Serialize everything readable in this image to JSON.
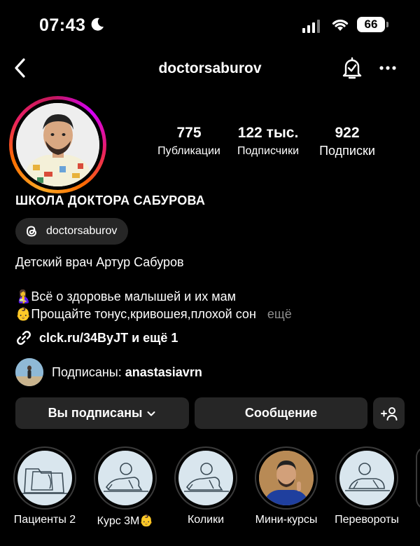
{
  "status_bar": {
    "time": "07:43",
    "battery": "66"
  },
  "header": {
    "username": "doctorsaburov"
  },
  "profile": {
    "stats": [
      {
        "value": "775",
        "label": "Публикации"
      },
      {
        "value": "122 тыс.",
        "label": "Подписчики"
      },
      {
        "value": "922",
        "label": "Подписки"
      }
    ],
    "full_name": "ШКОЛА ДОКТОРА САБУРОВА",
    "threads_handle": "doctorsaburov",
    "bio": {
      "line1": "Детский врач Артур Сабуров",
      "line2": "🤱Всё о здоровье малышей и их мам",
      "line3": "👶Прощайте тонус,кривошея,плохой сон",
      "more": "ещё"
    },
    "link": "clck.ru/34ByJT и ещё 1",
    "followed_by_prefix": "Подписаны: ",
    "followed_by_user": "anastasiavrn"
  },
  "actions": {
    "following_label": "Вы подписаны",
    "message_label": "Сообщение"
  },
  "highlights": [
    {
      "label": "Пациенты 2"
    },
    {
      "label": "Курс 3М👶"
    },
    {
      "label": "Колики"
    },
    {
      "label": "Мини-курсы"
    },
    {
      "label": "Перевороты"
    }
  ]
}
